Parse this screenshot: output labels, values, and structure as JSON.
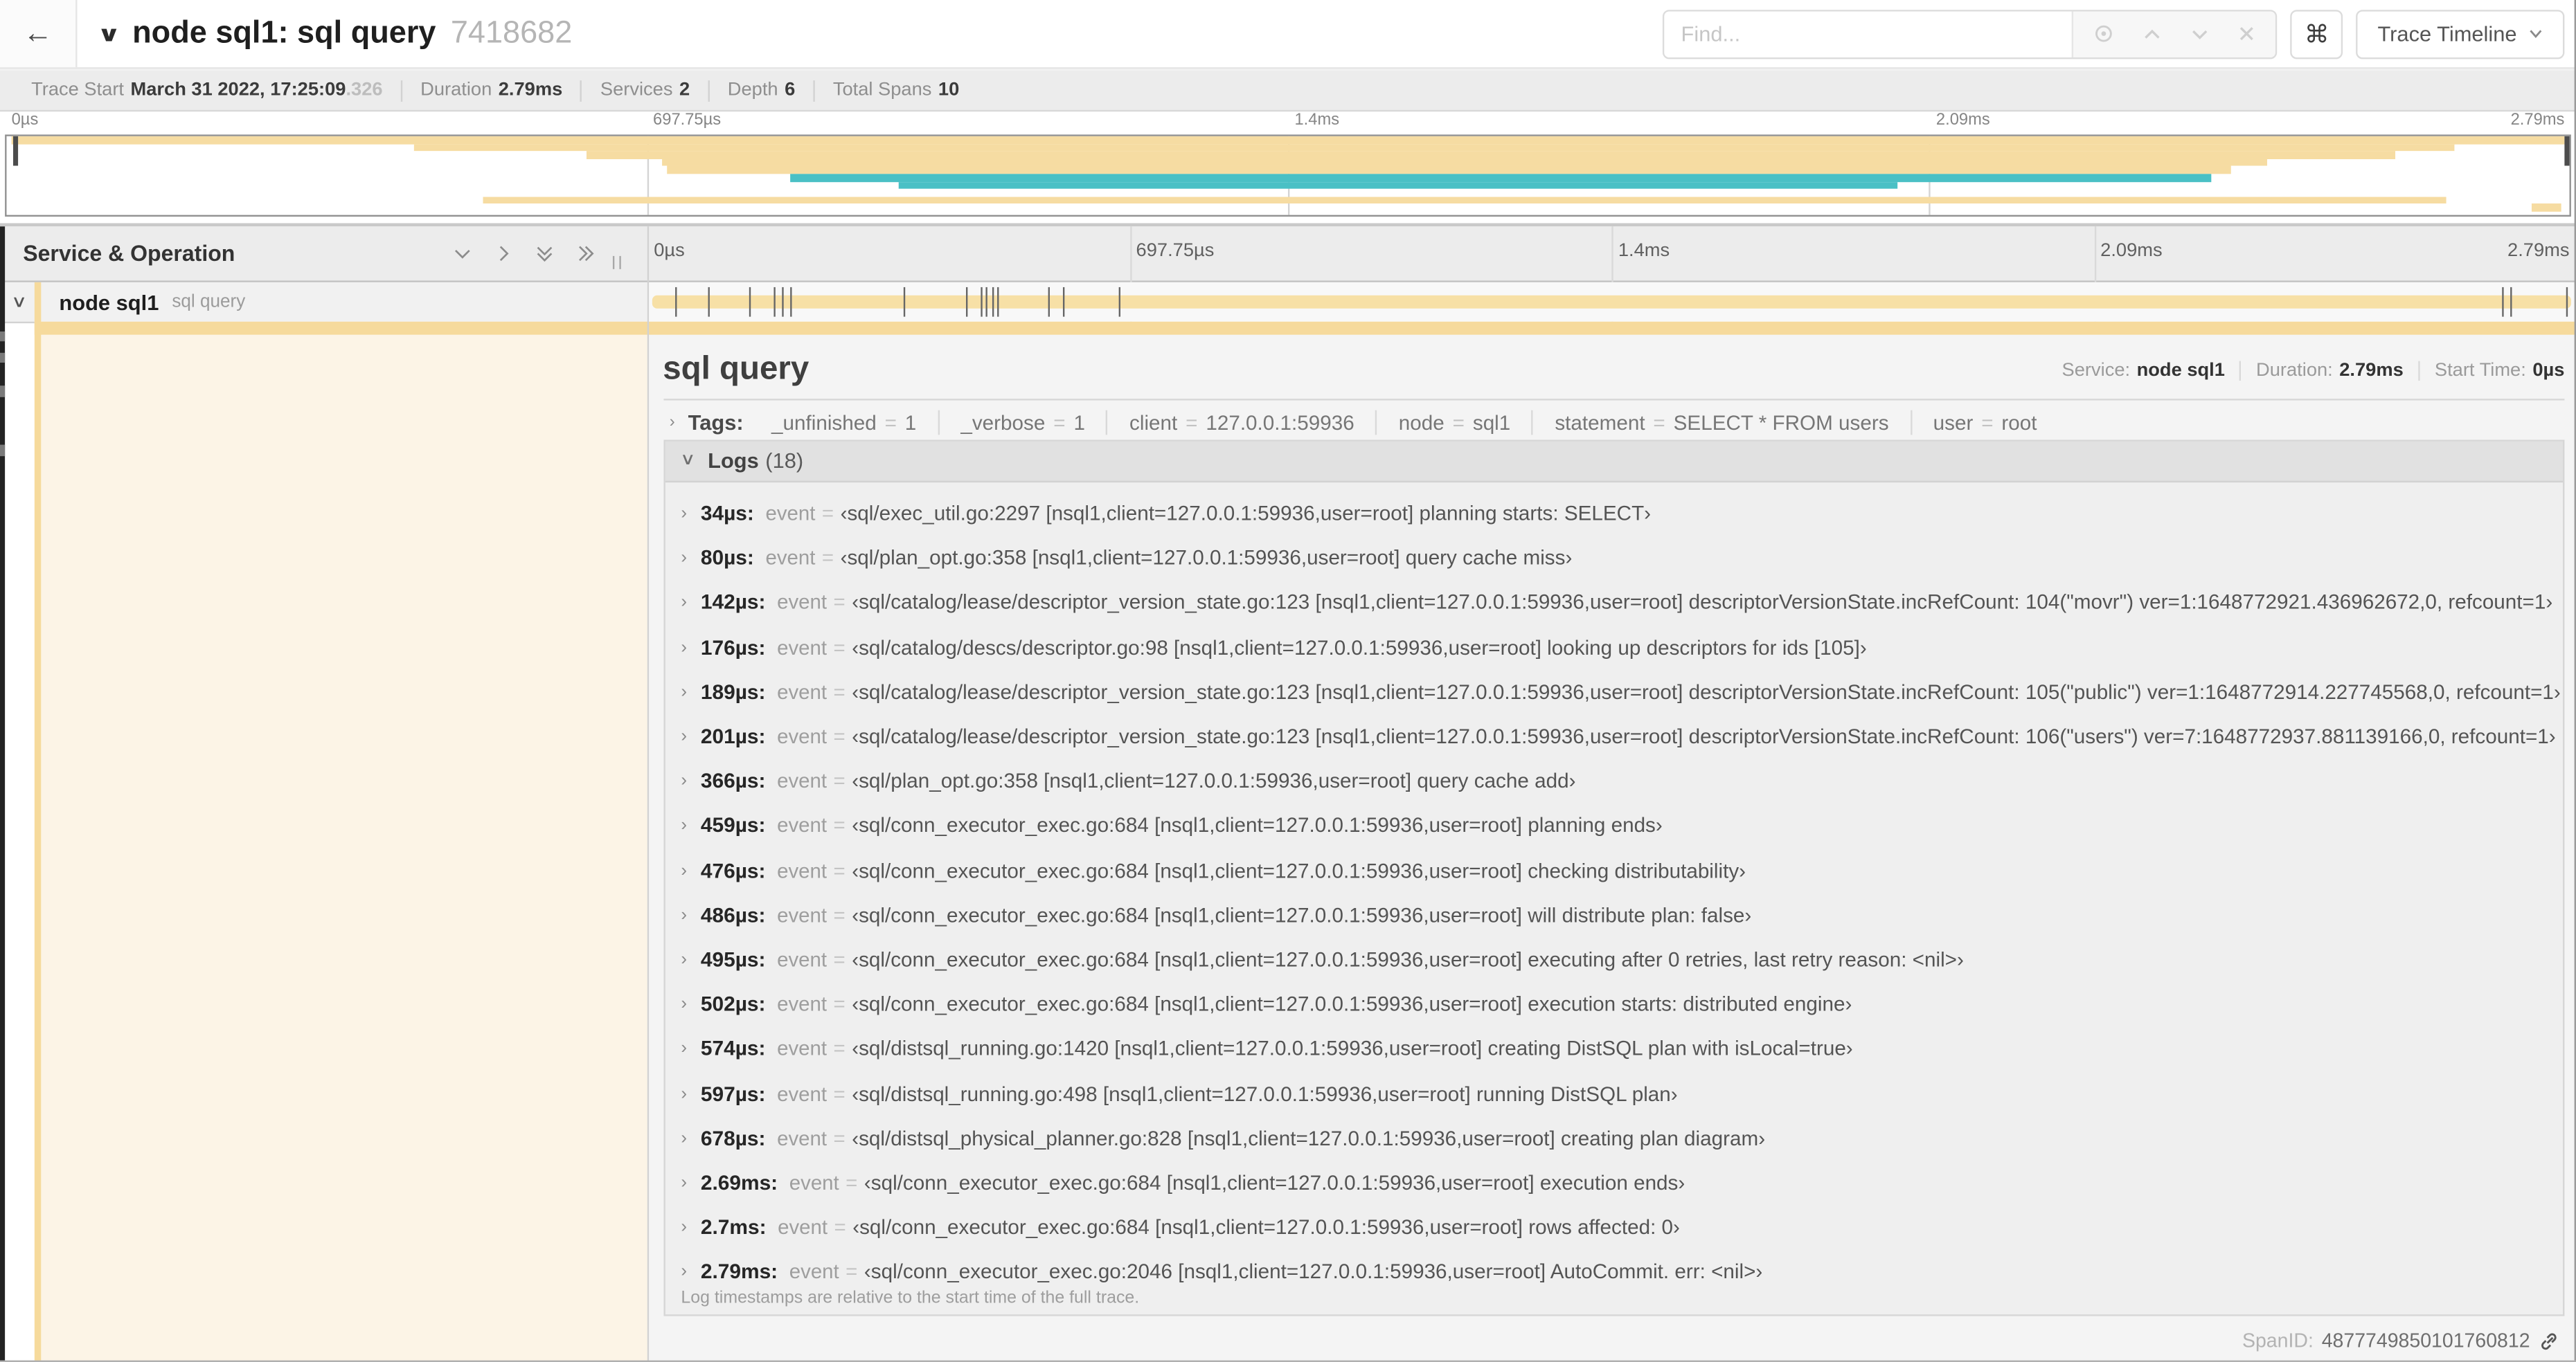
{
  "header": {
    "back_icon": "←",
    "collapse_icon": "∨",
    "title": "node sql1: sql query",
    "trace_id_short": "7418682",
    "find_placeholder": "Find...",
    "keyboard_shortcut": "⌘",
    "view_selector": "Trace Timeline"
  },
  "trace_summary": {
    "items": [
      {
        "label": "Trace Start",
        "value": "March 31 2022, 17:25:09",
        "suffix": ".326"
      },
      {
        "label": "Duration",
        "value": "2.79ms"
      },
      {
        "label": "Services",
        "value": "2"
      },
      {
        "label": "Depth",
        "value": "6"
      },
      {
        "label": "Total Spans",
        "value": "10"
      }
    ]
  },
  "timeline": {
    "ticks": [
      "0µs",
      "697.75µs",
      "1.4ms",
      "2.09ms",
      "2.79ms"
    ],
    "tick_positions_pct": [
      0,
      25,
      50,
      75,
      100
    ],
    "minimap_rows": [
      {
        "start_pct": 0.2,
        "end_pct": 99.8,
        "color": "tan"
      },
      {
        "start_pct": 15.9,
        "end_pct": 95.5,
        "color": "tan"
      },
      {
        "start_pct": 22.6,
        "end_pct": 93.2,
        "color": "tan"
      },
      {
        "start_pct": 25.6,
        "end_pct": 88.2,
        "color": "tan"
      },
      {
        "start_pct": 25.8,
        "end_pct": 86.8,
        "color": "tan"
      },
      {
        "start_pct": 30.6,
        "end_pct": 86.0,
        "color": "teal"
      },
      {
        "start_pct": 34.8,
        "end_pct": 73.8,
        "color": "teal"
      },
      {
        "start_pct": 0,
        "end_pct": 0,
        "color": "none"
      },
      {
        "start_pct": 18.6,
        "end_pct": 95.2,
        "color": "tan"
      },
      {
        "start_pct": 98.5,
        "end_pct": 99.7,
        "color": "tan"
      }
    ],
    "span_log_tick_pcts": [
      1.2,
      2.9,
      5.1,
      6.3,
      6.8,
      7.2,
      13.1,
      16.4,
      17.1,
      17.4,
      17.7,
      18.0,
      20.6,
      21.4,
      24.3,
      96.4,
      96.8,
      99.7
    ]
  },
  "tree": {
    "header": "Service & Operation",
    "row": {
      "chevron": "∨",
      "service": "node sql1",
      "operation": "sql query"
    }
  },
  "detail": {
    "title": "sql query",
    "meta": [
      {
        "label": "Service:",
        "value": "node sql1"
      },
      {
        "label": "Duration:",
        "value": "2.79ms"
      },
      {
        "label": "Start Time:",
        "value": "0µs"
      }
    ],
    "tags": {
      "chevron": "›",
      "label": "Tags:",
      "pairs": [
        {
          "key": "_unfinished",
          "value": "1"
        },
        {
          "key": "_verbose",
          "value": "1"
        },
        {
          "key": "client",
          "value": "127.0.0.1:59936"
        },
        {
          "key": "node",
          "value": "sql1"
        },
        {
          "key": "statement",
          "value": "SELECT * FROM users"
        },
        {
          "key": "user",
          "value": "root"
        }
      ]
    },
    "logs": {
      "chevron": "∨",
      "label": "Logs",
      "count": "(18)",
      "entries": [
        {
          "time": "34µs:",
          "field": "event",
          "eq": "=",
          "value": "‹sql/exec_util.go:2297 [nsql1,client=127.0.0.1:59936,user=root] planning starts: SELECT›"
        },
        {
          "time": "80µs:",
          "field": "event",
          "eq": "=",
          "value": "‹sql/plan_opt.go:358 [nsql1,client=127.0.0.1:59936,user=root] query cache miss›"
        },
        {
          "time": "142µs:",
          "field": "event",
          "eq": "=",
          "value": "‹sql/catalog/lease/descriptor_version_state.go:123 [nsql1,client=127.0.0.1:59936,user=root] descriptorVersionState.incRefCount: 104(\"movr\") ver=1:1648772921.436962672,0, refcount=1›"
        },
        {
          "time": "176µs:",
          "field": "event",
          "eq": "=",
          "value": "‹sql/catalog/descs/descriptor.go:98 [nsql1,client=127.0.0.1:59936,user=root] looking up descriptors for ids [105]›"
        },
        {
          "time": "189µs:",
          "field": "event",
          "eq": "=",
          "value": "‹sql/catalog/lease/descriptor_version_state.go:123 [nsql1,client=127.0.0.1:59936,user=root] descriptorVersionState.incRefCount: 105(\"public\") ver=1:1648772914.227745568,0, refcount=1›"
        },
        {
          "time": "201µs:",
          "field": "event",
          "eq": "=",
          "value": "‹sql/catalog/lease/descriptor_version_state.go:123 [nsql1,client=127.0.0.1:59936,user=root] descriptorVersionState.incRefCount: 106(\"users\") ver=7:1648772937.881139166,0, refcount=1›"
        },
        {
          "time": "366µs:",
          "field": "event",
          "eq": "=",
          "value": "‹sql/plan_opt.go:358 [nsql1,client=127.0.0.1:59936,user=root] query cache add›"
        },
        {
          "time": "459µs:",
          "field": "event",
          "eq": "=",
          "value": "‹sql/conn_executor_exec.go:684 [nsql1,client=127.0.0.1:59936,user=root] planning ends›"
        },
        {
          "time": "476µs:",
          "field": "event",
          "eq": "=",
          "value": "‹sql/conn_executor_exec.go:684 [nsql1,client=127.0.0.1:59936,user=root] checking distributability›"
        },
        {
          "time": "486µs:",
          "field": "event",
          "eq": "=",
          "value": "‹sql/conn_executor_exec.go:684 [nsql1,client=127.0.0.1:59936,user=root] will distribute plan: false›"
        },
        {
          "time": "495µs:",
          "field": "event",
          "eq": "=",
          "value": "‹sql/conn_executor_exec.go:684 [nsql1,client=127.0.0.1:59936,user=root] executing after 0 retries, last retry reason: <nil>›"
        },
        {
          "time": "502µs:",
          "field": "event",
          "eq": "=",
          "value": "‹sql/conn_executor_exec.go:684 [nsql1,client=127.0.0.1:59936,user=root] execution starts: distributed engine›"
        },
        {
          "time": "574µs:",
          "field": "event",
          "eq": "=",
          "value": "‹sql/distsql_running.go:1420 [nsql1,client=127.0.0.1:59936,user=root] creating DistSQL plan with isLocal=true›"
        },
        {
          "time": "597µs:",
          "field": "event",
          "eq": "=",
          "value": "‹sql/distsql_running.go:498 [nsql1,client=127.0.0.1:59936,user=root] running DistSQL plan›"
        },
        {
          "time": "678µs:",
          "field": "event",
          "eq": "=",
          "value": "‹sql/distsql_physical_planner.go:828 [nsql1,client=127.0.0.1:59936,user=root] creating plan diagram›"
        },
        {
          "time": "2.69ms:",
          "field": "event",
          "eq": "=",
          "value": "‹sql/conn_executor_exec.go:684 [nsql1,client=127.0.0.1:59936,user=root] execution ends›"
        },
        {
          "time": "2.7ms:",
          "field": "event",
          "eq": "=",
          "value": "‹sql/conn_executor_exec.go:684 [nsql1,client=127.0.0.1:59936,user=root] rows affected: 0›"
        },
        {
          "time": "2.79ms:",
          "field": "event",
          "eq": "=",
          "value": "‹sql/conn_executor_exec.go:2046 [nsql1,client=127.0.0.1:59936,user=root] AutoCommit. err: <nil>›"
        }
      ],
      "note": "Log timestamps are relative to the start time of the full trace."
    },
    "footer": {
      "label": "SpanID:",
      "value": "4877749850101760812"
    }
  }
}
